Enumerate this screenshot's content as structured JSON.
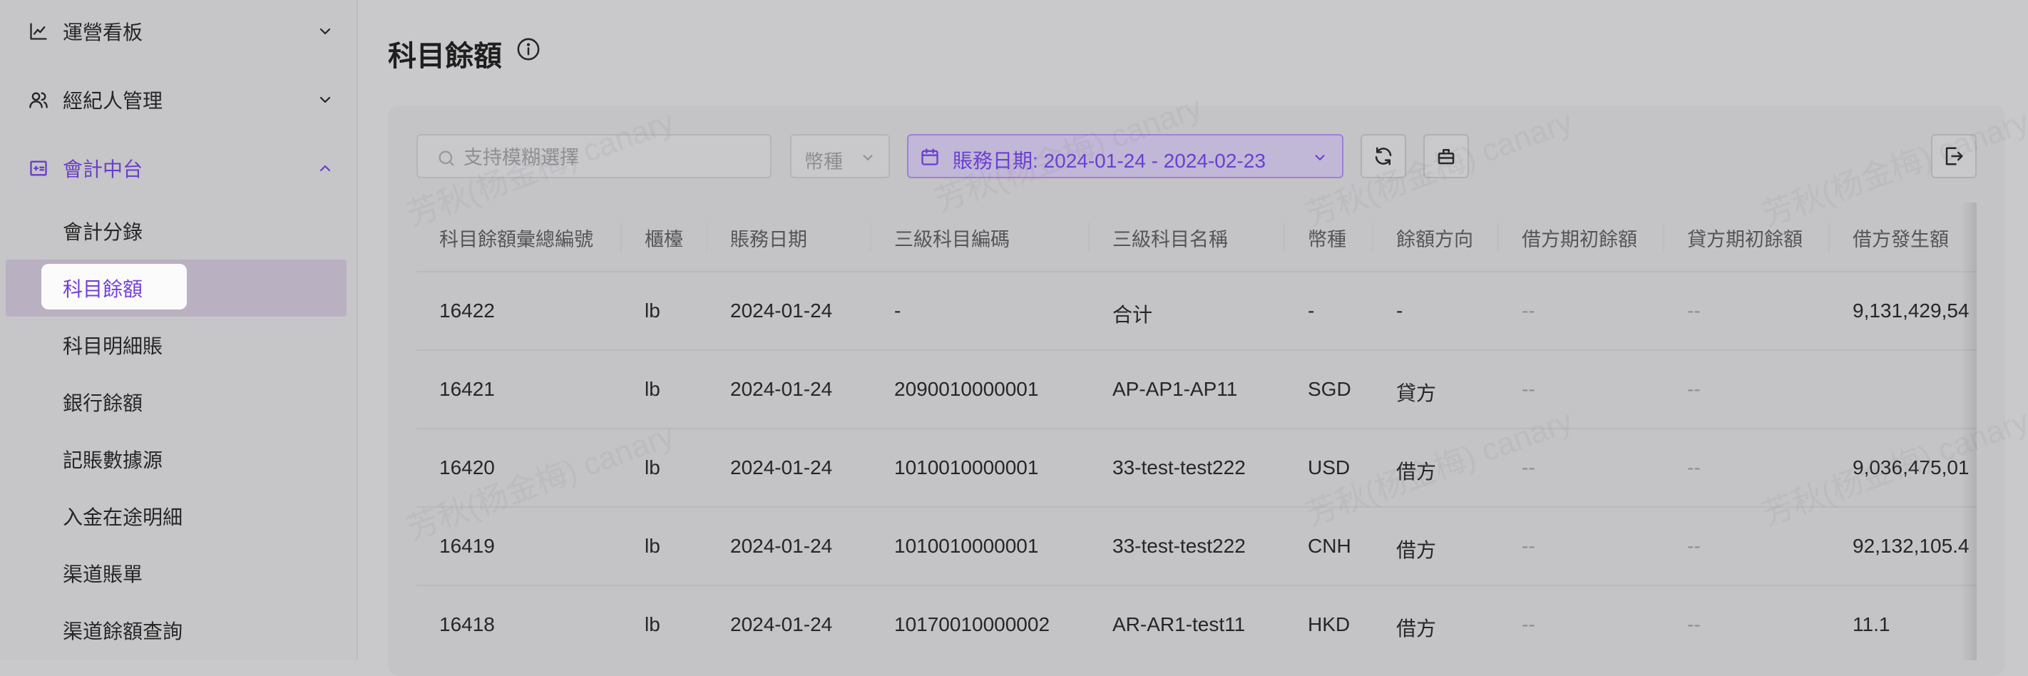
{
  "sidebar": {
    "groups": [
      {
        "label": "運營看板",
        "icon": "line-chart-icon",
        "expanded": false
      },
      {
        "label": "經紀人管理",
        "icon": "users-icon",
        "expanded": false
      },
      {
        "label": "會計中台",
        "icon": "accounting-icon",
        "expanded": true
      }
    ],
    "items": [
      {
        "label": "會計分錄"
      },
      {
        "label": "科目餘額",
        "active": true
      },
      {
        "label": "科目明細賬"
      },
      {
        "label": "銀行餘額"
      },
      {
        "label": "記賬數據源"
      },
      {
        "label": "入金在途明細"
      },
      {
        "label": "渠道賬單"
      },
      {
        "label": "渠道餘額查詢"
      }
    ]
  },
  "page": {
    "title": "科目餘額",
    "watermark": "芳秋(杨金梅) canary"
  },
  "toolbar": {
    "search_placeholder": "支持模糊選擇",
    "currency_label": "幣種",
    "date_filter_label": "賬務日期: 2024-01-24 - 2024-02-23"
  },
  "table": {
    "columns": [
      "科目餘額彙總編號",
      "櫃檯",
      "賬務日期",
      "三級科目編碼",
      "三級科目名稱",
      "幣種",
      "餘額方向",
      "借方期初餘額",
      "貸方期初餘額",
      "借方發生額"
    ],
    "rows": [
      [
        "16422",
        "lb",
        "2024-01-24",
        "-",
        "合计",
        "-",
        "-",
        "--",
        "--",
        "9,131,429,54"
      ],
      [
        "16421",
        "lb",
        "2024-01-24",
        "2090010000001",
        "AP-AP1-AP11",
        "SGD",
        "貸方",
        "--",
        "--",
        ""
      ],
      [
        "16420",
        "lb",
        "2024-01-24",
        "1010010000001",
        "33-test-test222",
        "USD",
        "借方",
        "--",
        "--",
        "9,036,475,01"
      ],
      [
        "16419",
        "lb",
        "2024-01-24",
        "1010010000001",
        "33-test-test222",
        "CNH",
        "借方",
        "--",
        "--",
        "92,132,105.4"
      ],
      [
        "16418",
        "lb",
        "2024-01-24",
        "10170010000002",
        "AR-AR1-test11",
        "HKD",
        "借方",
        "--",
        "--",
        "11.1"
      ]
    ]
  },
  "colors": {
    "accent": "#6b3fd0",
    "page_bg": "#c9c8cb",
    "active_item_bg": "#b9b1c2"
  }
}
